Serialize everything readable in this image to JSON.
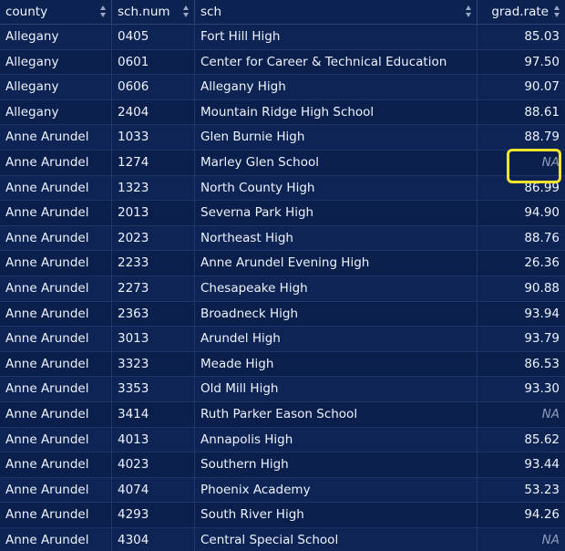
{
  "table": {
    "columns": [
      {
        "label": "county",
        "icon": "sort-icon"
      },
      {
        "label": "sch.num",
        "icon": "sort-icon"
      },
      {
        "label": "sch",
        "icon": "sort-icon"
      },
      {
        "label": "grad.rate",
        "icon": "sort-icon"
      }
    ],
    "rows": [
      {
        "county": "Allegany",
        "sch_num": "0405",
        "sch": "Fort Hill High",
        "grad_rate": "85.03"
      },
      {
        "county": "Allegany",
        "sch_num": "0601",
        "sch": "Center for Career & Technical Education",
        "grad_rate": "97.50"
      },
      {
        "county": "Allegany",
        "sch_num": "0606",
        "sch": "Allegany High",
        "grad_rate": "90.07"
      },
      {
        "county": "Allegany",
        "sch_num": "2404",
        "sch": "Mountain Ridge High School",
        "grad_rate": "88.61"
      },
      {
        "county": "Anne Arundel",
        "sch_num": "1033",
        "sch": "Glen Burnie High",
        "grad_rate": "88.79"
      },
      {
        "county": "Anne Arundel",
        "sch_num": "1274",
        "sch": "Marley Glen School",
        "grad_rate": "NA"
      },
      {
        "county": "Anne Arundel",
        "sch_num": "1323",
        "sch": "North County High",
        "grad_rate": "86.99"
      },
      {
        "county": "Anne Arundel",
        "sch_num": "2013",
        "sch": "Severna Park High",
        "grad_rate": "94.90"
      },
      {
        "county": "Anne Arundel",
        "sch_num": "2023",
        "sch": "Northeast High",
        "grad_rate": "88.76"
      },
      {
        "county": "Anne Arundel",
        "sch_num": "2233",
        "sch": "Anne Arundel Evening High",
        "grad_rate": "26.36"
      },
      {
        "county": "Anne Arundel",
        "sch_num": "2273",
        "sch": "Chesapeake High",
        "grad_rate": "90.88"
      },
      {
        "county": "Anne Arundel",
        "sch_num": "2363",
        "sch": "Broadneck High",
        "grad_rate": "93.94"
      },
      {
        "county": "Anne Arundel",
        "sch_num": "3013",
        "sch": "Arundel High",
        "grad_rate": "93.79"
      },
      {
        "county": "Anne Arundel",
        "sch_num": "3323",
        "sch": "Meade High",
        "grad_rate": "86.53"
      },
      {
        "county": "Anne Arundel",
        "sch_num": "3353",
        "sch": "Old Mill High",
        "grad_rate": "93.30"
      },
      {
        "county": "Anne Arundel",
        "sch_num": "3414",
        "sch": "Ruth Parker Eason School",
        "grad_rate": "NA"
      },
      {
        "county": "Anne Arundel",
        "sch_num": "4013",
        "sch": "Annapolis High",
        "grad_rate": "85.62"
      },
      {
        "county": "Anne Arundel",
        "sch_num": "4023",
        "sch": "Southern High",
        "grad_rate": "93.44"
      },
      {
        "county": "Anne Arundel",
        "sch_num": "4074",
        "sch": "Phoenix Academy",
        "grad_rate": "53.23"
      },
      {
        "county": "Anne Arundel",
        "sch_num": "4293",
        "sch": "South River High",
        "grad_rate": "94.26"
      },
      {
        "county": "Anne Arundel",
        "sch_num": "4304",
        "sch": "Central Special School",
        "grad_rate": "NA"
      }
    ]
  },
  "colors": {
    "background": "#0b2150",
    "text": "#eef2fb",
    "na_text": "#8e9cb8",
    "highlight": "#f1e42c"
  }
}
